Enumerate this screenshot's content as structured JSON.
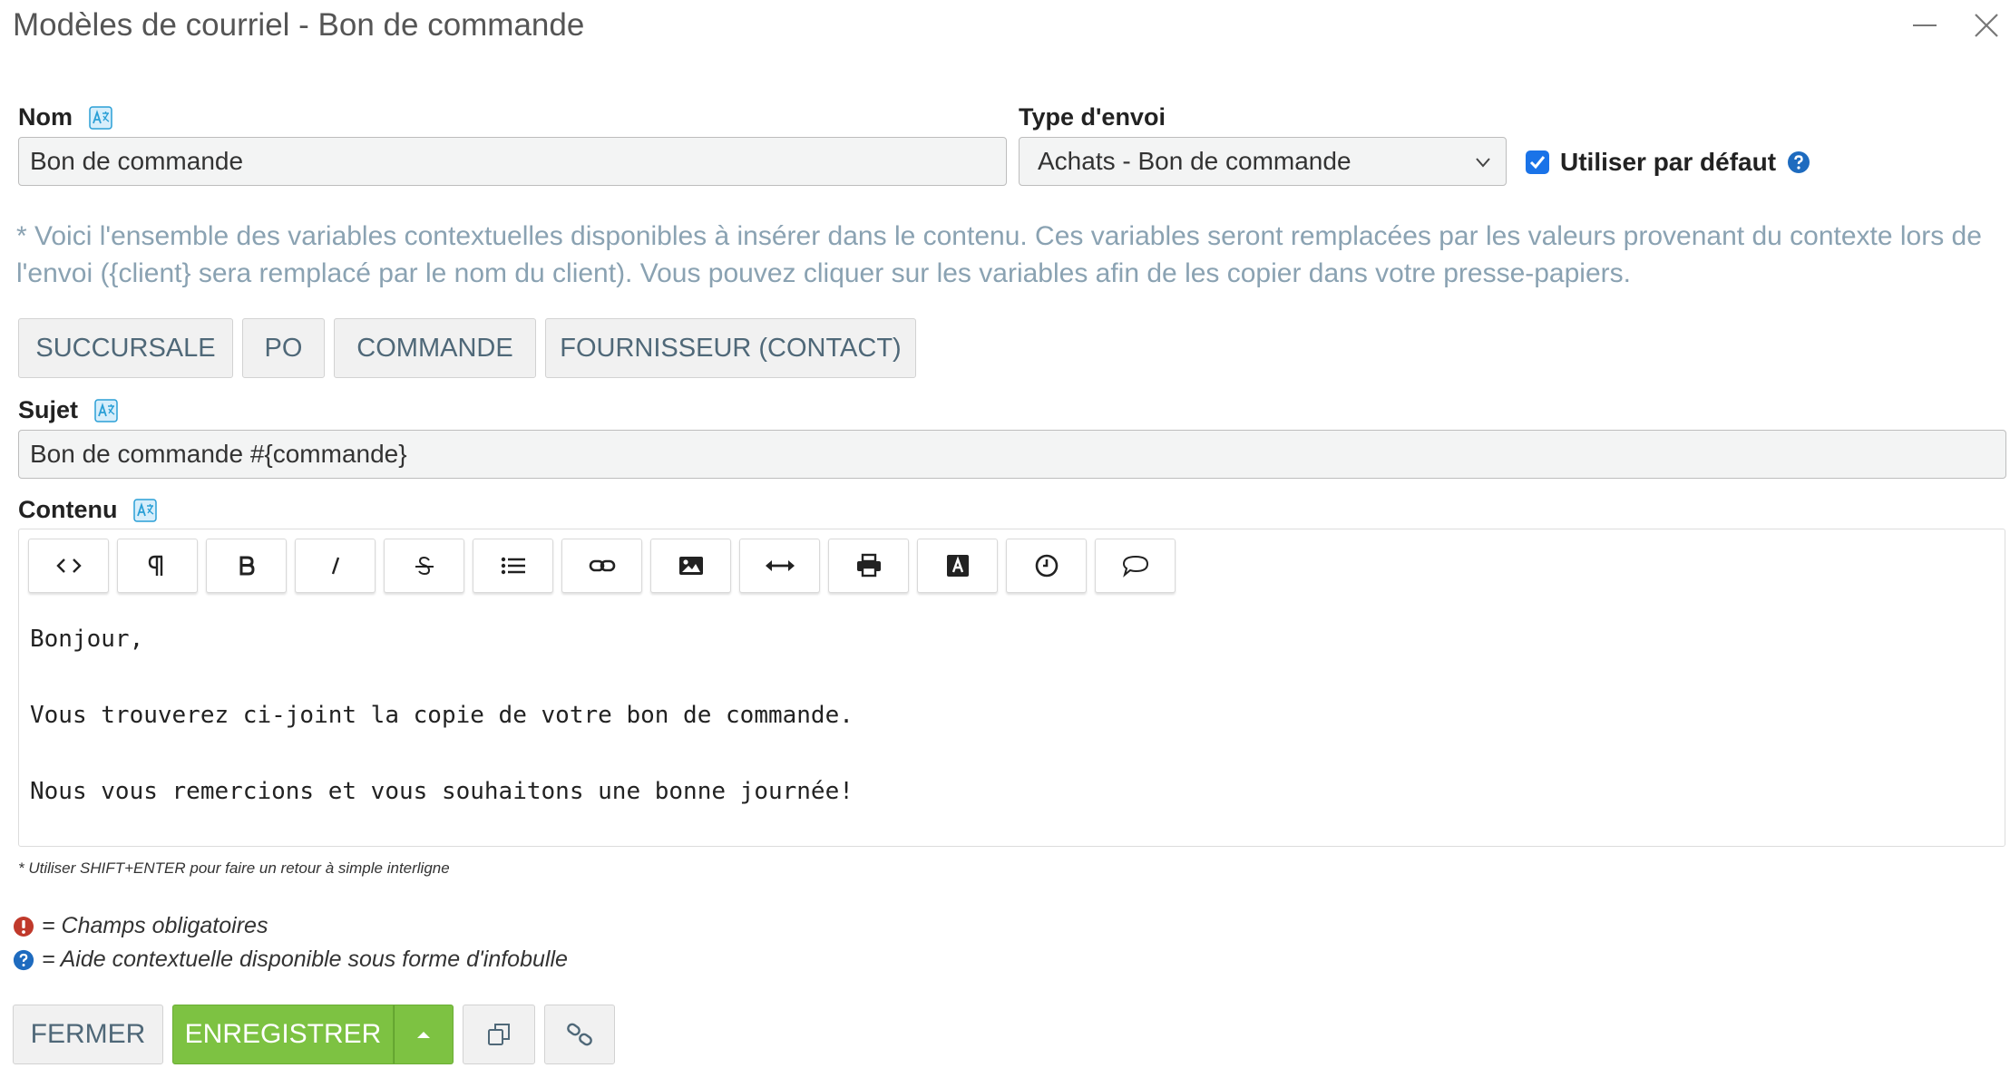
{
  "window": {
    "title": "Modèles de courriel - Bon de commande"
  },
  "form": {
    "nom_label": "Nom",
    "nom_value": "Bon de commande",
    "type_label": "Type d'envoi",
    "type_value": "Achats - Bon de commande",
    "default_label": "Utiliser par défaut",
    "default_checked": true,
    "info_text": "* Voici l'ensemble des variables contextuelles disponibles à insérer dans le contenu. Ces variables seront remplacées par les valeurs provenant du contexte lors de l'envoi ({client} sera remplacé par le nom du client). Vous pouvez cliquer sur les variables afin de les copier dans votre presse-papiers.",
    "variables": [
      "SUCCURSALE",
      "PO",
      "COMMANDE",
      "FOURNISSEUR (CONTACT)"
    ],
    "sujet_label": "Sujet",
    "sujet_value": "Bon de commande #{commande}",
    "contenu_label": "Contenu"
  },
  "editor": {
    "toolbar": [
      "code-icon",
      "paragraph-icon",
      "bold-icon",
      "italic-icon",
      "strikethrough-icon",
      "list-icon",
      "link-icon",
      "image-icon",
      "horizontal-rule-icon",
      "print-icon",
      "font-color-icon",
      "clock-icon",
      "comment-icon"
    ],
    "lines": [
      "Bonjour,",
      "Vous trouverez ci-joint la copie de votre bon de commande.",
      "Nous vous remercions et vous souhaitons une bonne journée!"
    ]
  },
  "hint": "* Utiliser SHIFT+ENTER pour faire un retour à simple interligne",
  "legend": {
    "required": "= Champs obligatoires",
    "help": "= Aide contextuelle disponible sous forme d'infobulle"
  },
  "footer": {
    "close": "FERMER",
    "save": "ENREGISTRER"
  },
  "colors": {
    "accent_green": "#7dc242",
    "checkbox_blue": "#1a73e8",
    "required_red": "#c0392b",
    "help_blue": "#1e6bbf"
  }
}
